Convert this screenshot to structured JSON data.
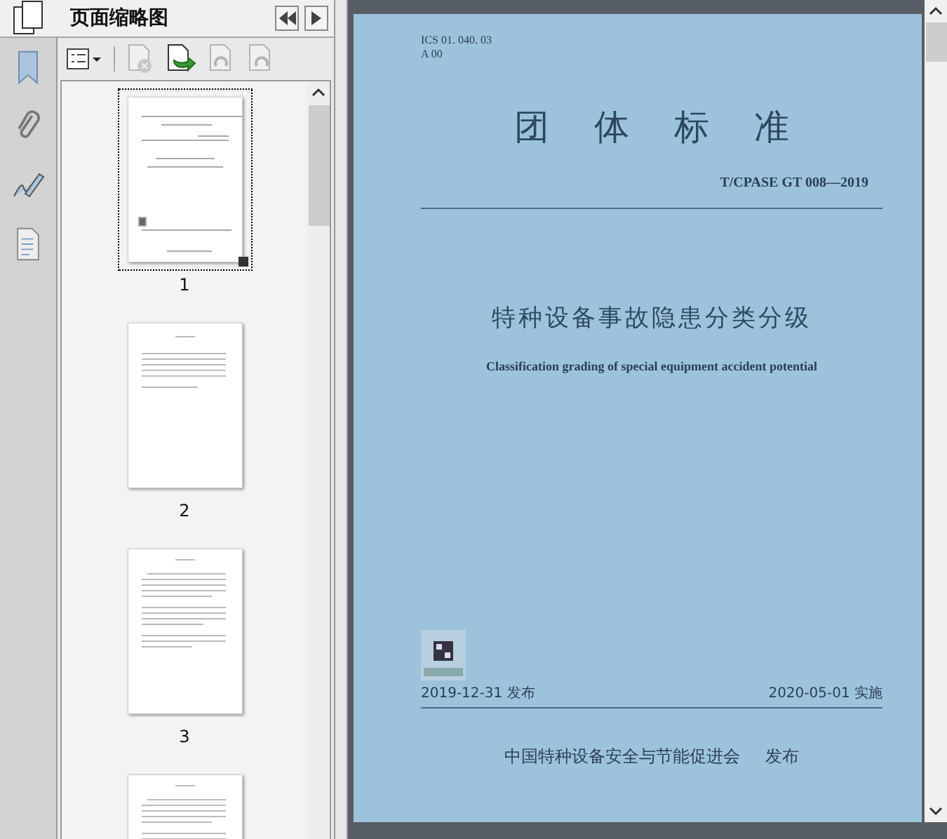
{
  "panel": {
    "title": "页面缩略图"
  },
  "rail": [
    {
      "kind": "bookmark"
    },
    {
      "kind": "attachment"
    },
    {
      "kind": "signature"
    },
    {
      "kind": "pages"
    }
  ],
  "toolbar": [
    {
      "kind": "options",
      "disabled": false
    },
    {
      "kind": "delete",
      "disabled": true
    },
    {
      "kind": "insert",
      "disabled": false
    },
    {
      "kind": "rotate-left",
      "disabled": true
    },
    {
      "kind": "rotate-right",
      "disabled": true
    }
  ],
  "thumbnails": [
    {
      "label": "1",
      "selected": true,
      "kind": "cover"
    },
    {
      "label": "2",
      "selected": false,
      "kind": "contents"
    },
    {
      "label": "3",
      "selected": false,
      "kind": "text"
    },
    {
      "selected": false,
      "kind": "text"
    }
  ],
  "document": {
    "ics": "ICS 01. 040. 03",
    "classification": "A 00",
    "heading": "团体标准",
    "code": "T/CPASE GT 008—2019",
    "title_zh": "特种设备事故隐患分类分级",
    "title_en": "Classification grading of special equipment accident potential",
    "issue_date": "2019-12-31 发布",
    "effective_date": "2020-05-01 实施",
    "publisher": "中国特种设备安全与节能促进会",
    "publisher_action": "发布"
  }
}
